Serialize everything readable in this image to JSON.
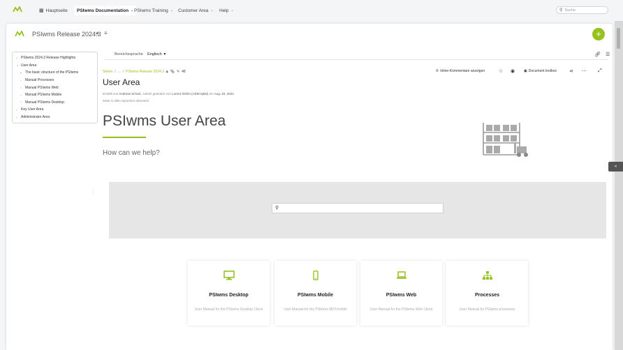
{
  "topnav": {
    "home": "Hauptseite",
    "documentation": "PSIwms Documentation",
    "training": "PSIwms Training",
    "customer": "Customer Area",
    "help": "Help",
    "search_placeholder": "Suche"
  },
  "space": {
    "title": "PSIwms Release 2024.3"
  },
  "tree": {
    "items": [
      {
        "label": "PSIwms 2024.3 Release Highlights",
        "level": 0,
        "chev": "›"
      },
      {
        "label": "User Area",
        "level": 0,
        "chev": "⌄"
      },
      {
        "label": "The basic structure of the PSIwms",
        "level": 1,
        "chev": "•"
      },
      {
        "label": "Manual Processes",
        "level": 1,
        "chev": "›"
      },
      {
        "label": "Manual PSIwms Web",
        "level": 1,
        "chev": "›"
      },
      {
        "label": "Manual PSIwms Mobile",
        "level": 1,
        "chev": "›"
      },
      {
        "label": "Manual PSIwms Desktop",
        "level": 1,
        "chev": "›"
      },
      {
        "label": "Key User Area",
        "level": 0,
        "chev": "›"
      },
      {
        "label": "Administrator Area",
        "level": 0,
        "chev": "›"
      }
    ]
  },
  "toolbar": {
    "lang_label": "Bereichssprache",
    "lang_value": "Englisch"
  },
  "breadcrumb": {
    "root": "Seiten",
    "ellipsis": "...",
    "current": "PSIwms Release 2024.3",
    "count": "48"
  },
  "page_actions": {
    "comments": "Inline-Kommentare anzeigen",
    "toolbox": "Document toolbox"
  },
  "page": {
    "title": "User Area",
    "meta_created": "Erstellt von",
    "meta_author": "Andreas Schulz",
    "meta_changed": ", zuletzt geändert von",
    "meta_editor": "Lorenz Böhm (ADM Iqbal)",
    "meta_on": "am",
    "meta_date": "Aug. 20, 2024",
    "meta_translated": "Seite in allen Sprachen übersetzt"
  },
  "hero": {
    "title": "PSIwms User Area",
    "subtitle": "How can we help?"
  },
  "tiles": [
    {
      "title": "PSIwms Desktop",
      "desc": "User Manual for the PSIwms Desktop Client",
      "icon": "desktop-icon"
    },
    {
      "title": "PSIwms Mobile",
      "desc": "User Manual for the PSIwms MDTmobile",
      "icon": "mobile-icon"
    },
    {
      "title": "PSIwms Web",
      "desc": "User Manual for the PSIwms Web Client",
      "icon": "laptop-icon"
    },
    {
      "title": "Processes",
      "desc": "User Manual for PSIwms processes",
      "icon": "sitemap-icon"
    }
  ],
  "colors": {
    "accent": "#96c11f",
    "band": "#e6e6e6"
  }
}
